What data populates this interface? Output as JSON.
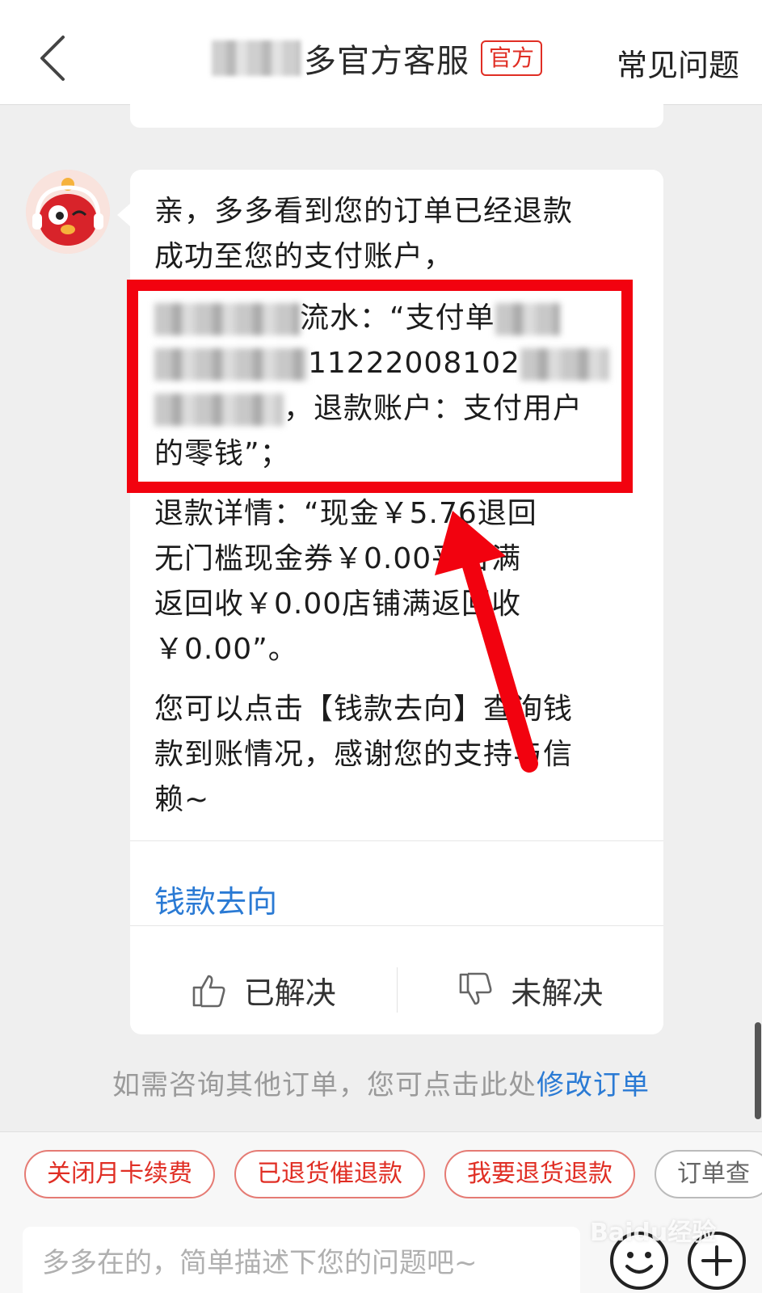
{
  "header": {
    "title": "多官方客服",
    "badge": "官方",
    "faq": "常见问题"
  },
  "message": {
    "line1": "亲，多多看到您的订单已经退款",
    "line2": "成功至您的支付账户，",
    "box_line1_text": "流水：“支付单",
    "box_line2_text": "11222008102",
    "box_line3_text": "退款账户：支付用户",
    "box_line4_text": "的零钱”；",
    "detail_line1": "退款详情：“现金￥5.76退回",
    "detail_line2": "无门槛现金券￥0.00平台满",
    "detail_line3": "返回收￥0.00店铺满返回收",
    "detail_line4": "￥0.00”。",
    "tip_line1": "您可以点击【钱款去向】查询钱",
    "tip_line2": "款到账情况，感谢您的支持与信",
    "tip_line3": "赖~",
    "money_link": "钱款去向",
    "resolved": "已解决",
    "unresolved": "未解决"
  },
  "hint": {
    "text": "如需咨询其他订单，您可点击此处",
    "link": "修改订单"
  },
  "quick_replies": [
    "关闭月卡续费",
    "已退货催退款",
    "我要退货退款",
    "订单查"
  ],
  "input": {
    "placeholder": "多多在的，简单描述下您的问题吧~"
  },
  "watermark": "Baidu经验",
  "colors": {
    "accent_red": "#e02e24",
    "highlight_red": "#f2020f",
    "link_blue": "#2a7ad4"
  }
}
